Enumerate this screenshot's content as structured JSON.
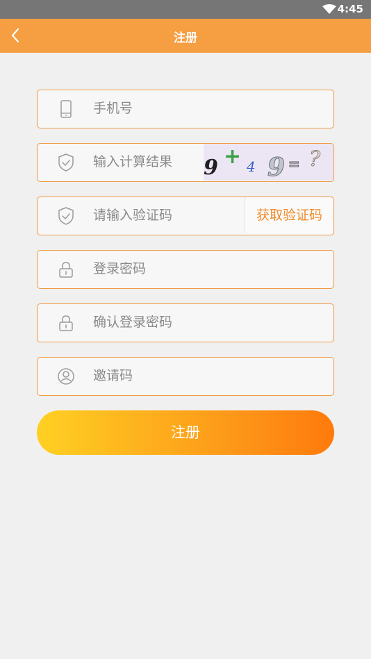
{
  "status_bar": {
    "time": "4:45",
    "icons": [
      "wifi-icon"
    ]
  },
  "app_bar": {
    "title": "注册",
    "back_icon": "back-arrow-icon"
  },
  "form": {
    "phone": {
      "placeholder": "手机号",
      "icon": "phone-icon"
    },
    "captcha": {
      "placeholder": "输入计算结果",
      "icon": "shield-check-icon",
      "image_text": "9+49=?"
    },
    "sms_code": {
      "placeholder": "请输入验证码",
      "icon": "shield-check-icon",
      "button_label": "获取验证码"
    },
    "password": {
      "placeholder": "登录密码",
      "icon": "lock-icon"
    },
    "confirm_password": {
      "placeholder": "确认登录密码",
      "icon": "lock-icon"
    },
    "invite_code": {
      "placeholder": "邀请码",
      "icon": "user-circle-icon"
    }
  },
  "submit_label": "注册",
  "colors": {
    "accent": "#f59e42",
    "border": "#ef9a44",
    "gradient_start": "#ffd023",
    "gradient_end": "#ff7a0c",
    "button_text": "#f08a2a"
  }
}
